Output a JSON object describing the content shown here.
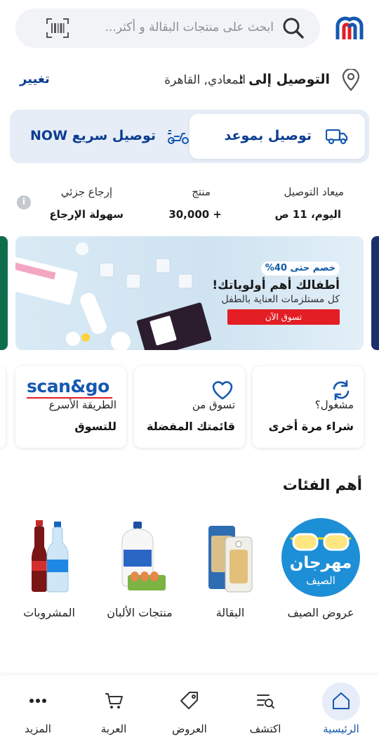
{
  "search": {
    "placeholder": "ابحث على منتجات البقالة و أكثر..."
  },
  "delivery": {
    "title": "التوصيل إلى :",
    "address": "المعادي, القاهرة",
    "change": "تغيير"
  },
  "toggle": {
    "scheduled": "توصيل بموعد",
    "express": "توصيل سريع NOW"
  },
  "info": [
    {
      "label": "ميعاد التوصيل",
      "value": "اليوم، 11 ص"
    },
    {
      "label": "منتج",
      "value": "30,000 +"
    },
    {
      "label": "إرجاع جزئي",
      "value": "سهولة الإرجاع"
    }
  ],
  "banner": {
    "badge": "خصم حتى 40%",
    "title": "أطفالك أهم أولوياتك!",
    "subtitle": "كل مستلزمات العناية بالطفل",
    "cta": "تسوق الآن"
  },
  "quick_cards": [
    {
      "line1": "مشغول؟",
      "line2": "شراء مرة أخرى",
      "icon": "refresh-icon"
    },
    {
      "line1": "تسوق من",
      "line2": "قائمتك المفضلة",
      "icon": "heart-icon"
    },
    {
      "logo": "scan&go",
      "line1": "الطريقة الأسرع",
      "line2": "للتسوق"
    }
  ],
  "categories_title": "أهم الفئات",
  "categories": [
    {
      "label": "عروض الصيف",
      "badge_line1": "مهرجان",
      "badge_line2": "الصيف"
    },
    {
      "label": "البقالة"
    },
    {
      "label": "منتجات الألبان"
    },
    {
      "label": "المشروبات"
    }
  ],
  "nav": [
    {
      "label": "الرئيسية",
      "icon": "home-icon",
      "active": true
    },
    {
      "label": "اكتشف",
      "icon": "discover-icon"
    },
    {
      "label": "العروض",
      "icon": "tag-icon"
    },
    {
      "label": "العربة",
      "icon": "cart-icon"
    },
    {
      "label": "المزيد",
      "icon": "more-icon"
    }
  ],
  "colors": {
    "brand_blue": "#0b3d91",
    "brand_red": "#e31e24",
    "toggle_bg": "#e7edf6"
  }
}
